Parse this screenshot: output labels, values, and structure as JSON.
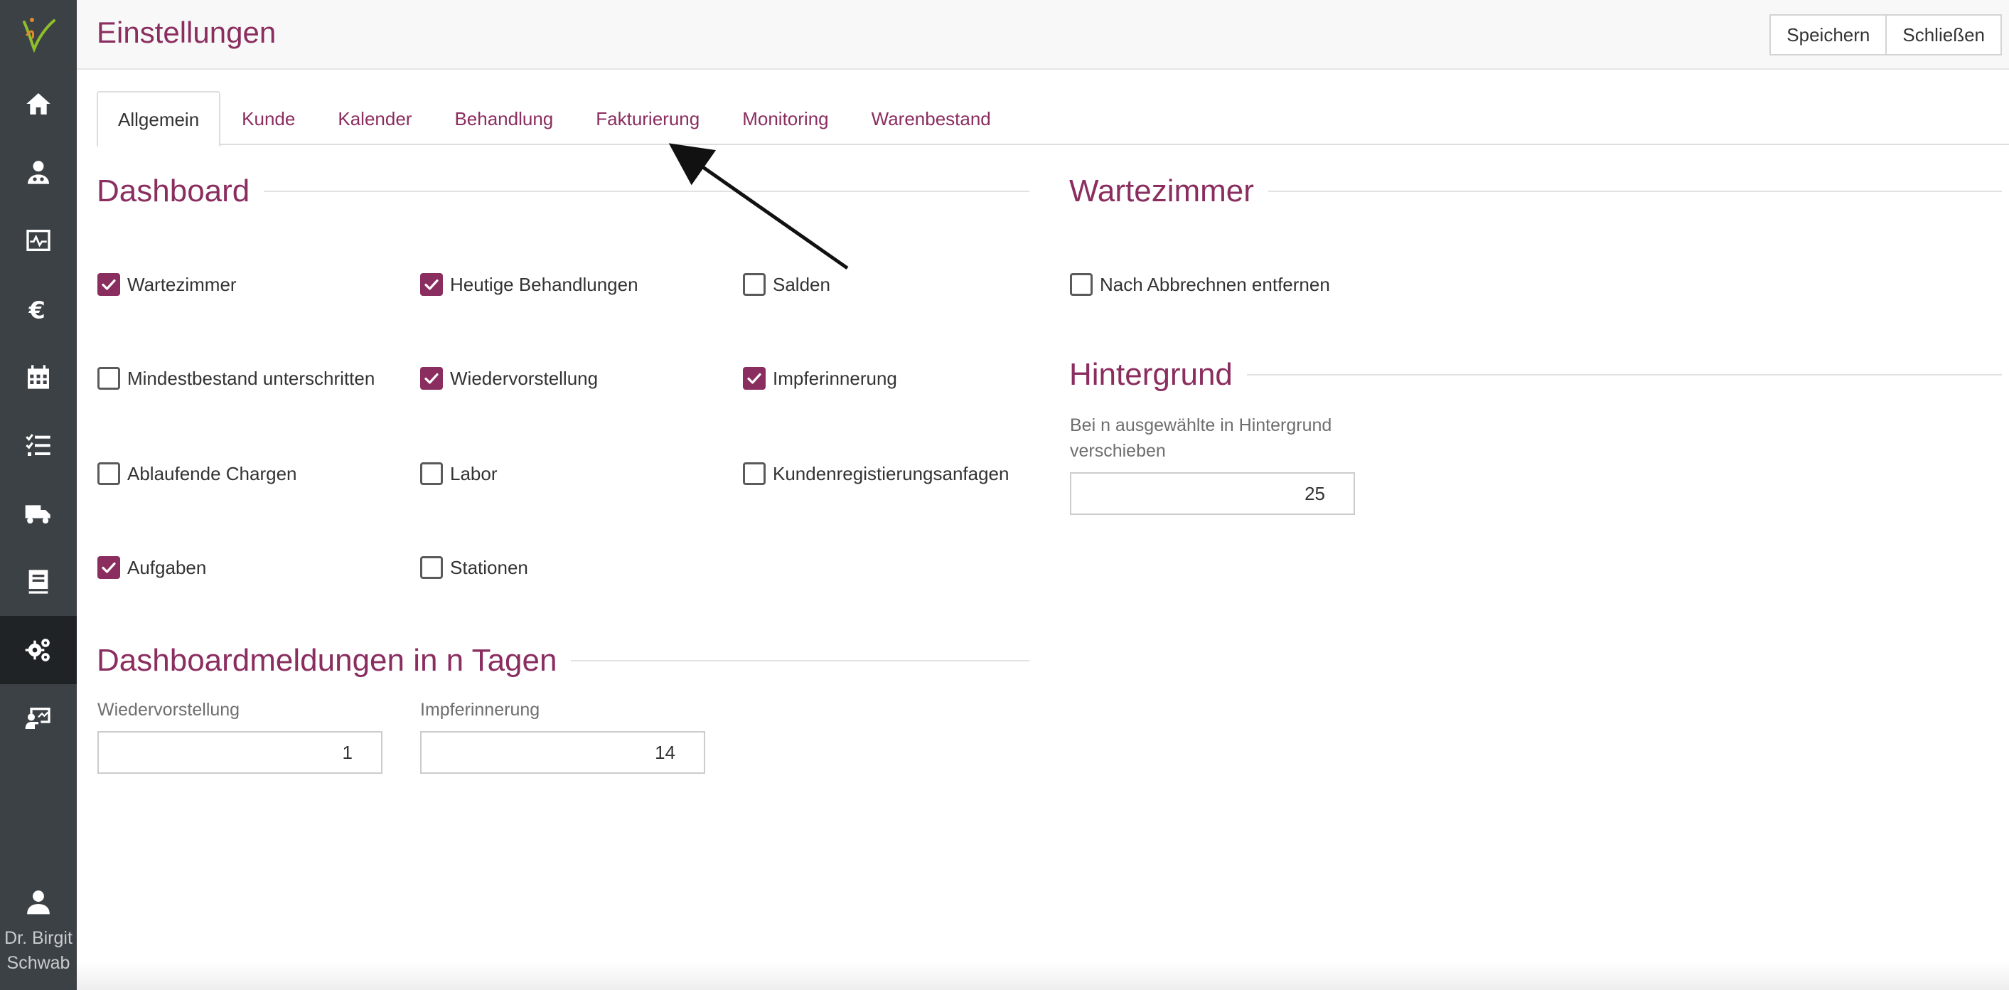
{
  "app": {
    "title": "Einstellungen",
    "brand_color": "#8a2d5f",
    "sidebar_color": "#3c4145"
  },
  "header": {
    "save_label": "Speichern",
    "close_label": "Schließen"
  },
  "sidebar": {
    "items": [
      {
        "icon": "home-icon",
        "active": false
      },
      {
        "icon": "doctor-icon",
        "active": false
      },
      {
        "icon": "monitor-chart-icon",
        "active": false
      },
      {
        "icon": "euro-icon",
        "active": false
      },
      {
        "icon": "calendar-icon",
        "active": false
      },
      {
        "icon": "tasks-list-icon",
        "active": false
      },
      {
        "icon": "truck-icon",
        "active": false
      },
      {
        "icon": "book-icon",
        "active": false
      },
      {
        "icon": "settings-gears-icon",
        "active": true
      },
      {
        "icon": "presentation-user-icon",
        "active": false
      }
    ],
    "user": {
      "icon": "user-icon",
      "name_line1": "Dr. Birgit",
      "name_line2": "Schwab"
    }
  },
  "tabs": [
    {
      "label": "Allgemein",
      "active": true
    },
    {
      "label": "Kunde",
      "active": false
    },
    {
      "label": "Kalender",
      "active": false
    },
    {
      "label": "Behandlung",
      "active": false
    },
    {
      "label": "Fakturierung",
      "active": false
    },
    {
      "label": "Monitoring",
      "active": false
    },
    {
      "label": "Warenbestand",
      "active": false
    }
  ],
  "dashboard": {
    "title": "Dashboard",
    "checkboxes": [
      {
        "label": "Wartezimmer",
        "checked": true
      },
      {
        "label": "Heutige Behandlungen",
        "checked": true
      },
      {
        "label": "Salden",
        "checked": false
      },
      {
        "label": "Mindestbestand unterschritten",
        "checked": false
      },
      {
        "label": "Wiedervorstellung",
        "checked": true
      },
      {
        "label": "Impferinnerung",
        "checked": true
      },
      {
        "label": "Ablaufende Chargen",
        "checked": false
      },
      {
        "label": "Labor",
        "checked": false
      },
      {
        "label": "Kundenregistierungsanfagen",
        "checked": false
      },
      {
        "label": "Aufgaben",
        "checked": true
      },
      {
        "label": "Stationen",
        "checked": false
      }
    ]
  },
  "dashboard_messages": {
    "title": "Dashboardmeldungen in n Tagen",
    "fields": [
      {
        "label": "Wiedervorstellung",
        "value": "1"
      },
      {
        "label": "Impferinnerung",
        "value": "14"
      }
    ]
  },
  "waiting_room": {
    "title": "Wartezimmer",
    "checkbox": {
      "label": "Nach Abbrechnen entfernen",
      "checked": false
    }
  },
  "background": {
    "title": "Hintergrund",
    "label_line1": "Bei n ausgewählte in Hintergrund",
    "label_line2": "verschieben",
    "value": "25"
  }
}
